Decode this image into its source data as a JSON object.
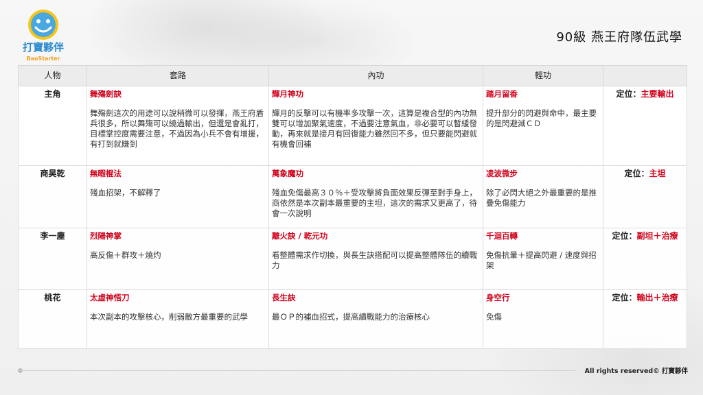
{
  "header": {
    "title": "90級 燕王府隊伍武學"
  },
  "logo": {
    "text": "打寶夥伴",
    "subtext": "BaoStarter",
    "icon": "smiley-logo-icon"
  },
  "table": {
    "headers": [
      "人物",
      "套路",
      "內功",
      "輕功",
      ""
    ],
    "rows": [
      {
        "character": "主角",
        "routine_name": "舞殤劍訣",
        "routine_desc": "舞殤劍這次的用途可以說稍微可以發揮，燕王府盾兵很多，所以舞殤可以繞過輸出，但還是會亂打，目標掌控度需要注意，不過因為小兵不會有增援，有打到就賺到",
        "inner_name": "輝月神功",
        "inner_desc": "輝月的反擊可以有機率多攻擊一次，這算是複合型的內功無雙可以增加聚氣速度，不過要注意氣血，非必要可以暫緩發動，再來就是接月有回復能力雖然回不多，但只要能閃避就有機會回補",
        "light_name": "踏月留香",
        "light_desc": "提升部分的閃避與命中，最主要的是閃避減ＣＤ",
        "position_label": "定位：",
        "position_value": "主要輸出"
      },
      {
        "character": "商昊乾",
        "routine_name": "無暇棍法",
        "routine_desc": "殘血招架，不解釋了",
        "inner_name": "萬象魔功",
        "inner_desc": "殘血免傷最高３０％＋受攻擊將負面效果反彈至對手身上，商依然是本次副本最重要的主坦，這次的需求又更高了，待會一次說明",
        "light_name": "凌波微步",
        "light_desc": "除了必閃大絕之外最重要的是推疊免傷能力",
        "position_label": "定位：",
        "position_value": "主坦"
      },
      {
        "character": "李一塵",
        "routine_name": "烈陽神掌",
        "routine_desc": "高反傷＋群攻＋燒灼",
        "inner_name": "離火訣 / 乾元功",
        "inner_desc": "看整體需求作切換，與長生訣搭配可以提高整體隊伍的續戰力",
        "light_name": "千迴百轉",
        "light_desc": "免傷抗暈＋提高閃避 / 速度與招架",
        "position_label": "定位：",
        "position_value": "副坦＋治療"
      },
      {
        "character": "桃花",
        "routine_name": "太虛神悟刀",
        "routine_desc": "本次副本的攻擊核心，削弱敵方最重要的武學",
        "inner_name": "長生訣",
        "inner_desc": "最ＯＰ的補血招式，提高續戰能力的治療核心",
        "light_name": "身空行",
        "light_desc": "免傷",
        "position_label": "定位：",
        "position_value": "輸出＋治療"
      }
    ]
  },
  "footer": {
    "copyright": "All rights reserved© 打寶夥伴"
  },
  "colors": {
    "accent": "#d0021b",
    "header_bg": "#ececec"
  }
}
